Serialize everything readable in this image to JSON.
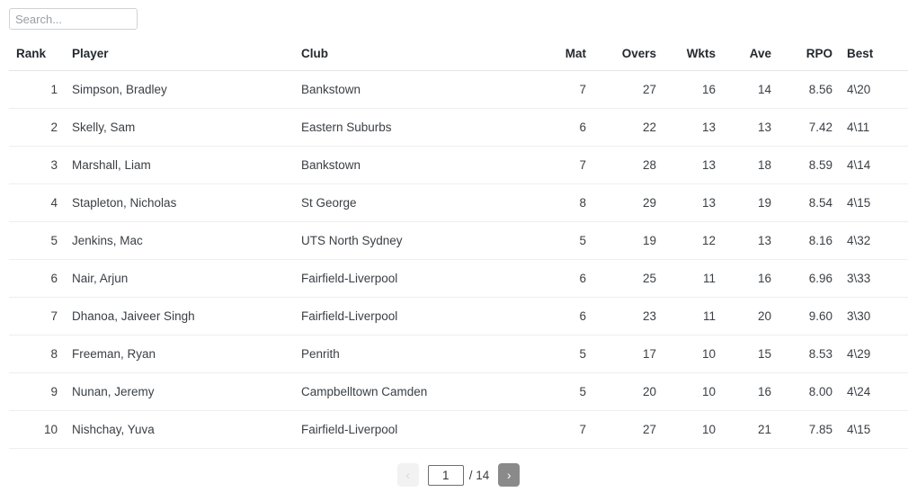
{
  "search": {
    "placeholder": "Search...",
    "value": ""
  },
  "table": {
    "columns": [
      {
        "key": "rank",
        "label": "Rank",
        "align": "left"
      },
      {
        "key": "player",
        "label": "Player",
        "align": "left"
      },
      {
        "key": "club",
        "label": "Club",
        "align": "left"
      },
      {
        "key": "mat",
        "label": "Mat",
        "align": "right"
      },
      {
        "key": "overs",
        "label": "Overs",
        "align": "right"
      },
      {
        "key": "wkts",
        "label": "Wkts",
        "align": "right"
      },
      {
        "key": "ave",
        "label": "Ave",
        "align": "right"
      },
      {
        "key": "rpo",
        "label": "RPO",
        "align": "right"
      },
      {
        "key": "best",
        "label": "Best",
        "align": "left"
      }
    ],
    "rows": [
      {
        "rank": "1",
        "player": "Simpson, Bradley",
        "club": "Bankstown",
        "mat": "7",
        "overs": "27",
        "wkts": "16",
        "ave": "14",
        "rpo": "8.56",
        "best": "4\\20"
      },
      {
        "rank": "2",
        "player": "Skelly, Sam",
        "club": "Eastern Suburbs",
        "mat": "6",
        "overs": "22",
        "wkts": "13",
        "ave": "13",
        "rpo": "7.42",
        "best": "4\\11"
      },
      {
        "rank": "3",
        "player": "Marshall, Liam",
        "club": "Bankstown",
        "mat": "7",
        "overs": "28",
        "wkts": "13",
        "ave": "18",
        "rpo": "8.59",
        "best": "4\\14"
      },
      {
        "rank": "4",
        "player": "Stapleton, Nicholas",
        "club": "St George",
        "mat": "8",
        "overs": "29",
        "wkts": "13",
        "ave": "19",
        "rpo": "8.54",
        "best": "4\\15"
      },
      {
        "rank": "5",
        "player": "Jenkins, Mac",
        "club": "UTS North Sydney",
        "mat": "5",
        "overs": "19",
        "wkts": "12",
        "ave": "13",
        "rpo": "8.16",
        "best": "4\\32"
      },
      {
        "rank": "6",
        "player": "Nair, Arjun",
        "club": "Fairfield-Liverpool",
        "mat": "6",
        "overs": "25",
        "wkts": "11",
        "ave": "16",
        "rpo": "6.96",
        "best": "3\\33"
      },
      {
        "rank": "7",
        "player": "Dhanoa, Jaiveer Singh",
        "club": "Fairfield-Liverpool",
        "mat": "6",
        "overs": "23",
        "wkts": "11",
        "ave": "20",
        "rpo": "9.60",
        "best": "3\\30"
      },
      {
        "rank": "8",
        "player": "Freeman, Ryan",
        "club": "Penrith",
        "mat": "5",
        "overs": "17",
        "wkts": "10",
        "ave": "15",
        "rpo": "8.53",
        "best": "4\\29"
      },
      {
        "rank": "9",
        "player": "Nunan, Jeremy",
        "club": "Campbelltown Camden",
        "mat": "5",
        "overs": "20",
        "wkts": "10",
        "ave": "16",
        "rpo": "8.00",
        "best": "4\\24"
      },
      {
        "rank": "10",
        "player": "Nishchay, Yuva",
        "club": "Fairfield-Liverpool",
        "mat": "7",
        "overs": "27",
        "wkts": "10",
        "ave": "21",
        "rpo": "7.85",
        "best": "4\\15"
      }
    ]
  },
  "pagination": {
    "prev_label": "‹",
    "next_label": "›",
    "current_page": "1",
    "total_label": "/ 14",
    "total_pages": "14",
    "prev_disabled": true
  },
  "colors": {
    "next_button_bg": "#8a8a8a",
    "prev_button_bg": "#f2f2f2",
    "header_border": "#e3e5e8",
    "row_border": "#edeef0"
  }
}
